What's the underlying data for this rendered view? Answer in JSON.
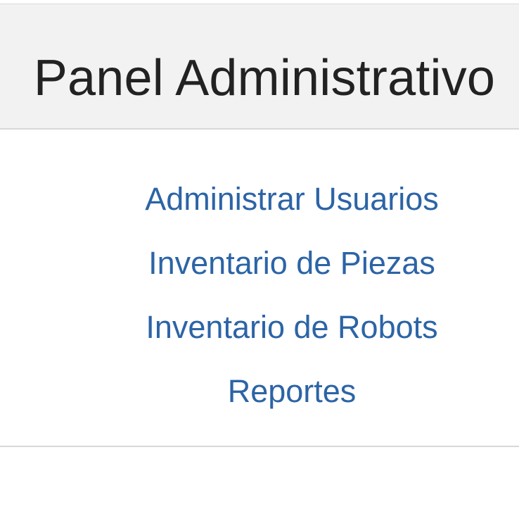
{
  "header": {
    "title": "Panel Administrativo"
  },
  "nav": {
    "items": [
      {
        "label": "Administrar Usuarios"
      },
      {
        "label": "Inventario de Piezas"
      },
      {
        "label": "Inventario de Robots"
      },
      {
        "label": "Reportes"
      }
    ]
  },
  "colors": {
    "link": "#2c64a6",
    "title": "#222222",
    "header_bg": "#f2f2f2",
    "divider": "#d8d8d8"
  }
}
